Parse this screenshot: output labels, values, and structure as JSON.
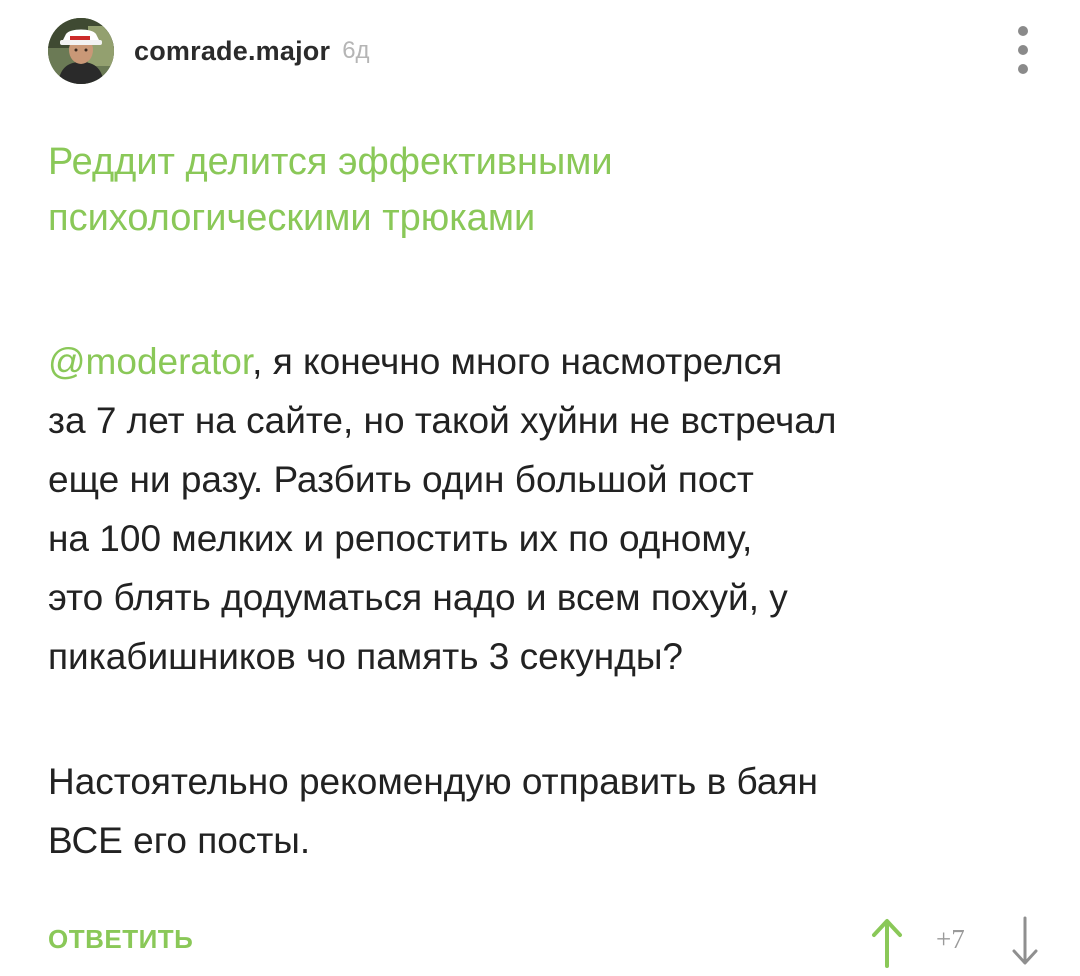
{
  "comment": {
    "author": "comrade.major",
    "time": "6д",
    "icons": {
      "avatar": "user-avatar",
      "menu": "more-vertical-icon",
      "upvote": "arrow-up-icon",
      "downvote": "arrow-down-icon"
    },
    "post_title_lines": [
      "Реддит делится эффективными",
      "психологическими трюками"
    ],
    "mention": "@moderator",
    "paragraph1_lines": [
      ", я конечно много насмотрелся",
      "за 7 лет на сайте, но такой хуйни не встречал",
      "еще ни разу. Разбить один большой пост",
      "на 100 мелких и репостить их по одному,",
      "это блять додуматься надо и всем похуй, у",
      "пикабишников чо память 3 секунды?"
    ],
    "paragraph2_lines": [
      "Настоятельно рекомендую отправить в баян",
      "ВСЕ его посты."
    ],
    "reply_label": "ОТВЕТИТЬ",
    "rating": "+7"
  },
  "colors": {
    "accent": "#8ac858",
    "text": "#222222",
    "muted": "#b5b5b5",
    "icon": "#8a8a8a"
  }
}
